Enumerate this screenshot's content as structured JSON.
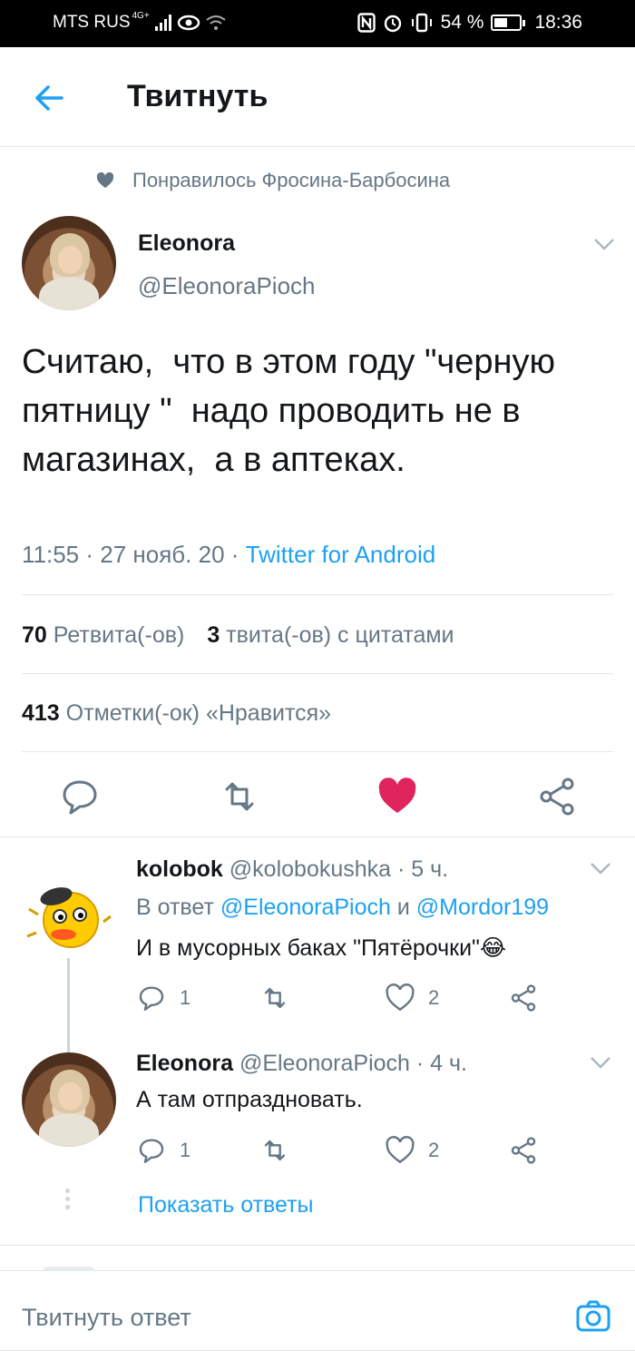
{
  "status_bar": {
    "carrier": "MTS RUS",
    "network": "4G+",
    "battery": "54 %",
    "battery_fraction": 0.54,
    "time": "18:36"
  },
  "header": {
    "title": "Твитнуть"
  },
  "liked_by": "Понравилось Фросина-Барбосина",
  "tweet": {
    "author_name": "Eleonora",
    "author_handle": "@EleonoraPioch",
    "text": "Считаю,  что в этом году \"черную пятницу \"  надо проводить не в магазинах,  а в аптеках.",
    "time_date": "11:55 · 27 нояб. 20 · ",
    "source": "Twitter for Android",
    "retweets_count": "70",
    "retweets_label": "Ретвита(-ов)",
    "quotes_count": "3",
    "quotes_label": "твита(-ов) с цитатами",
    "likes_count": "413",
    "likes_label": "Отметки(-ок) «Нравится»",
    "liked": true
  },
  "replies": [
    {
      "author_name": "kolobok",
      "author_handle": "@kolobokushka · 5 ч.",
      "reply_to_prefix": "В ответ ",
      "reply_to_user1": "@EleonoraPioch",
      "reply_to_and": " и ",
      "reply_to_user2": "@Mordor199",
      "text": "И в мусорных баках \"Пятёрочки\"😂",
      "reply_count": "1",
      "like_count": "2"
    },
    {
      "author_name": "Eleonora",
      "author_handle": "@EleonoraPioch · 4 ч.",
      "text": "А там отпраздновать.",
      "reply_count": "1",
      "like_count": "2"
    }
  ],
  "show_replies": "Показать ответы",
  "compose": {
    "placeholder": "Твитнуть ответ"
  },
  "colors": {
    "accent": "#1da1f2",
    "like": "#e0245e",
    "muted": "#657786",
    "text": "#14171a",
    "border": "#e1e8ed"
  }
}
